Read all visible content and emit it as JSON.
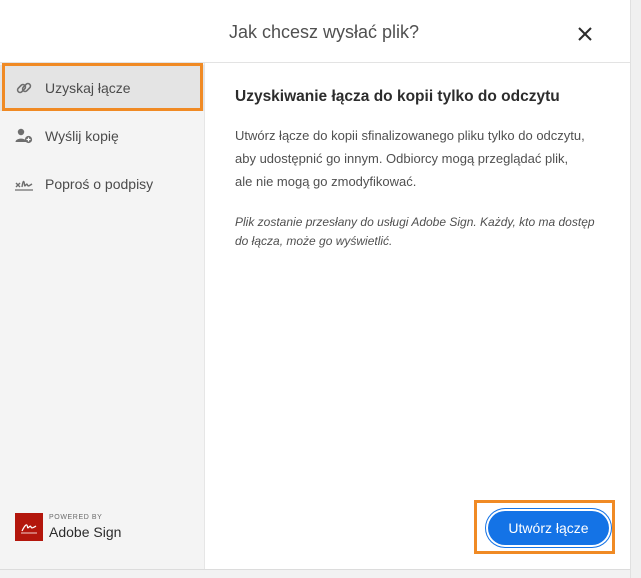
{
  "dialog": {
    "title": "Jak chcesz wysłać plik?",
    "close_icon": "close-icon"
  },
  "sidebar": {
    "items": [
      {
        "label": "Uzyskaj łącze",
        "icon": "link-icon",
        "selected": true
      },
      {
        "label": "Wyślij kopię",
        "icon": "add-person-icon",
        "selected": false
      },
      {
        "label": "Poproś o podpisy",
        "icon": "signature-icon",
        "selected": false
      }
    ],
    "powered_by": {
      "small": "POWERED BY",
      "brand": "Adobe Sign",
      "icon": "adobe-sign-logo-icon"
    }
  },
  "content": {
    "heading": "Uzyskiwanie łącza do kopii tylko do odczytu",
    "description": "Utwórz łącze do kopii sfinalizowanego pliku tylko do odczytu, aby udostępnić go innym. Odbiorcy mogą przeglądać plik, ale nie mogą go zmodyfikować.",
    "note": "Plik zostanie przesłany do usługi Adobe Sign. Każdy, kto ma dostęp do łącza, może go wyświetlić.",
    "primary_button": "Utwórz łącze"
  },
  "colors": {
    "accent_blue": "#1473e6",
    "highlight_orange": "#f08a24",
    "adobe_red": "#b3160c"
  }
}
